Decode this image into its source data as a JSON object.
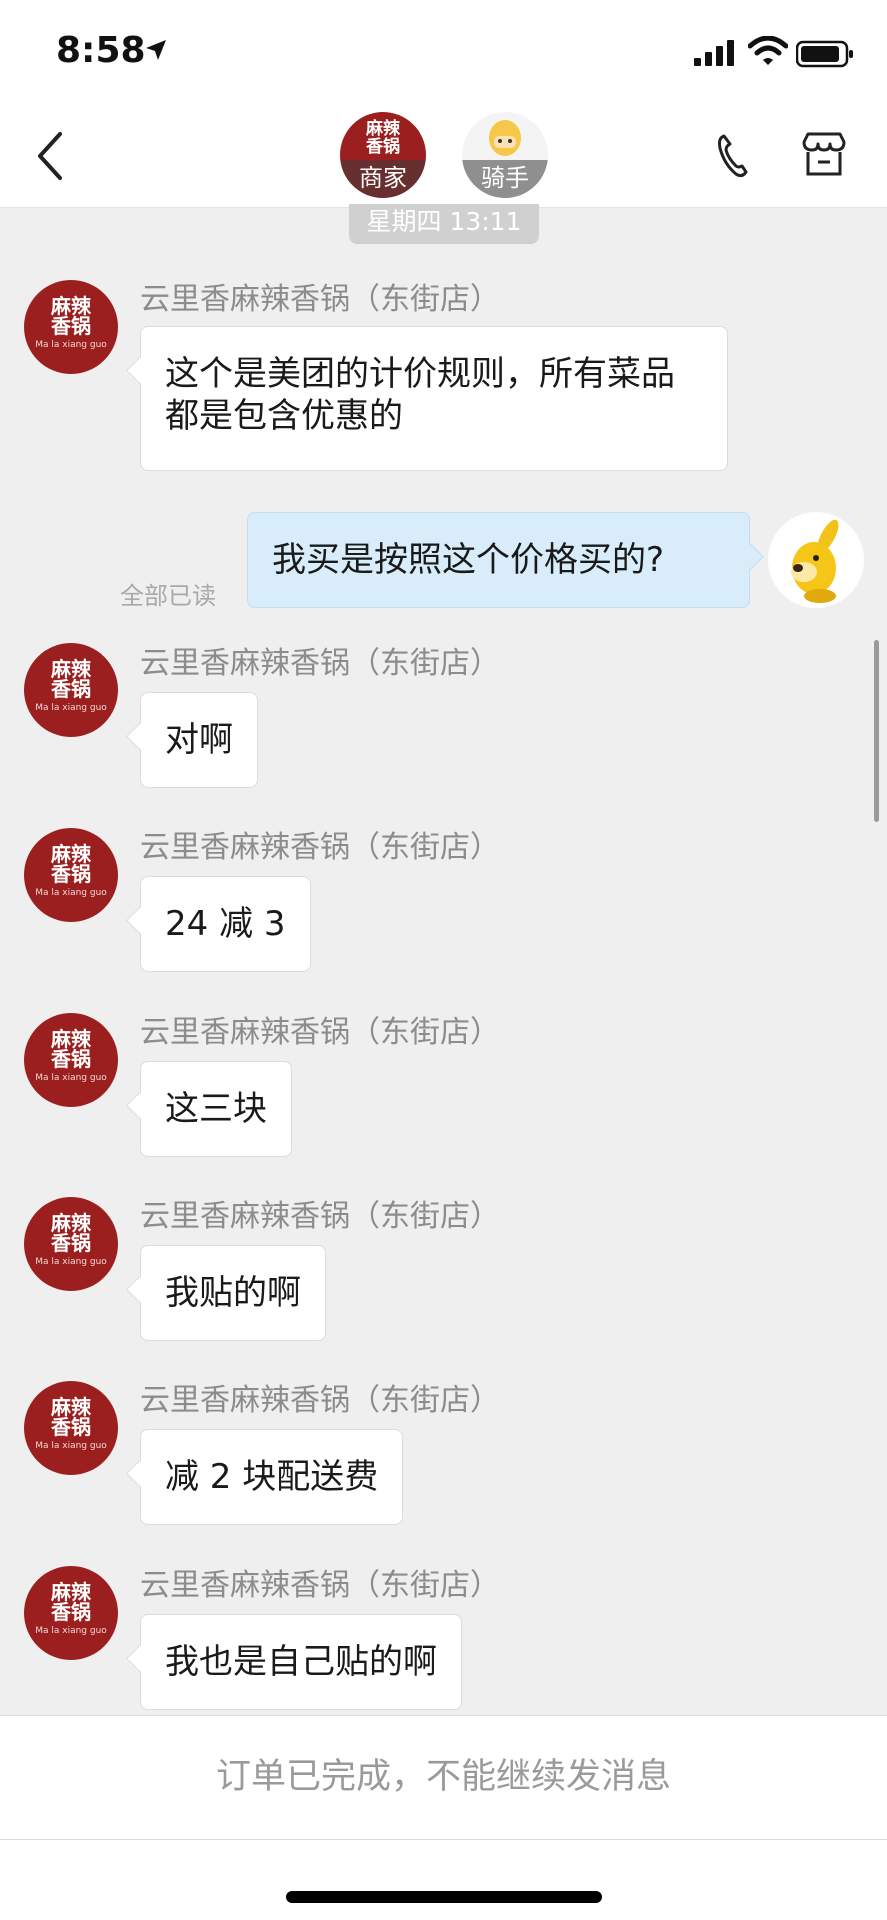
{
  "status_bar": {
    "time": "8:58",
    "icons": [
      "location-arrow-icon",
      "cellular-signal-icon",
      "wifi-icon",
      "battery-icon"
    ]
  },
  "header": {
    "back_icon": "chevron-left-icon",
    "merchant": {
      "logo_line1": "麻辣",
      "logo_line2": "香锅",
      "label": "商家"
    },
    "rider": {
      "label": "骑手"
    },
    "phone_icon": "phone-icon",
    "shop_icon": "store-icon"
  },
  "chat": {
    "date_divider": "星期四 13:11",
    "merchant_name": "云里香麻辣香锅（东街店）",
    "merchant_avatar": {
      "line1": "麻辣",
      "line2": "香锅",
      "subtitle": "Ma la xiang guo"
    },
    "messages": [
      {
        "from": "merchant",
        "text": "这个是美团的计价规则，所有菜品都是包含优惠的"
      },
      {
        "from": "me",
        "text": "我买是按照这个价格买的?",
        "status": "全部已读"
      },
      {
        "from": "merchant",
        "text": "对啊"
      },
      {
        "from": "merchant",
        "text": "24 减 3"
      },
      {
        "from": "merchant",
        "text": "这三块"
      },
      {
        "from": "merchant",
        "text": "我贴的啊"
      },
      {
        "from": "merchant",
        "text": "减 2 块配送费"
      },
      {
        "from": "merchant",
        "text": "我也是自己贴的啊"
      }
    ]
  },
  "footer": {
    "notice": "订单已完成，不能继续发消息"
  },
  "colors": {
    "merchant_red": "#9c1f1f",
    "my_bubble": "#d8ecfa",
    "background": "#efefef"
  }
}
